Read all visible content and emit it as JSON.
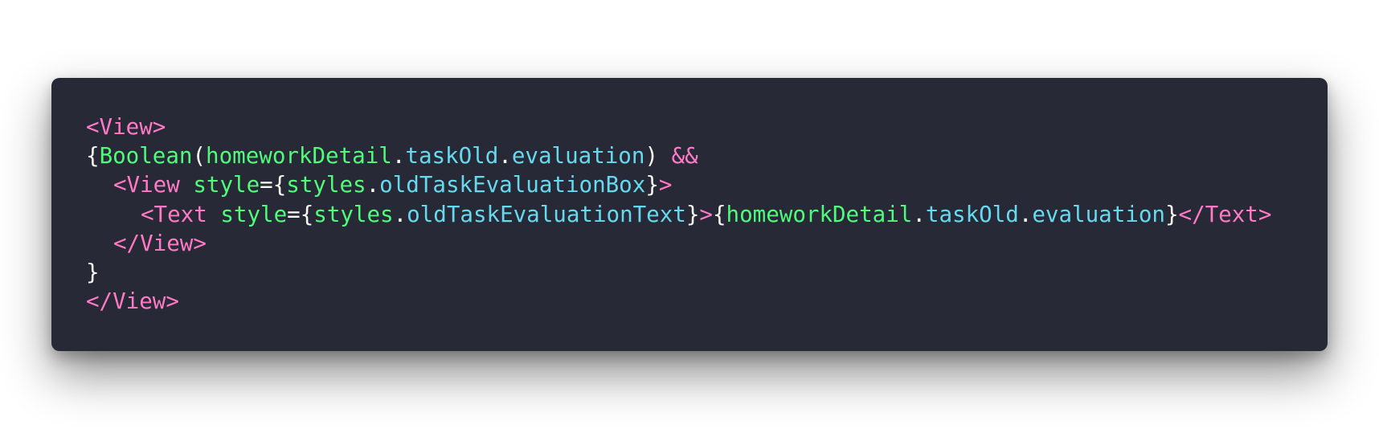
{
  "code": {
    "lines": [
      {
        "tokens": [
          {
            "t": "tag",
            "v": "<View>"
          }
        ]
      },
      {
        "tokens": [
          {
            "t": "punc",
            "v": "{"
          },
          {
            "t": "ident",
            "v": "Boolean"
          },
          {
            "t": "punc",
            "v": "("
          },
          {
            "t": "ident",
            "v": "homeworkDetail"
          },
          {
            "t": "punc",
            "v": "."
          },
          {
            "t": "prop",
            "v": "taskOld"
          },
          {
            "t": "punc",
            "v": "."
          },
          {
            "t": "prop",
            "v": "evaluation"
          },
          {
            "t": "punc",
            "v": ") "
          },
          {
            "t": "op",
            "v": "&&"
          }
        ]
      },
      {
        "tokens": [
          {
            "t": "tag",
            "v": "<View "
          },
          {
            "t": "attr",
            "v": "style"
          },
          {
            "t": "punc",
            "v": "={"
          },
          {
            "t": "ident",
            "v": "styles"
          },
          {
            "t": "punc",
            "v": "."
          },
          {
            "t": "prop",
            "v": "oldTaskEvaluationBox"
          },
          {
            "t": "punc",
            "v": "}"
          },
          {
            "t": "tag",
            "v": ">"
          }
        ]
      },
      {
        "tokens": [
          {
            "t": "tag",
            "v": "<Text "
          },
          {
            "t": "attr",
            "v": "style"
          },
          {
            "t": "punc",
            "v": "={"
          },
          {
            "t": "ident",
            "v": "styles"
          },
          {
            "t": "punc",
            "v": "."
          },
          {
            "t": "prop",
            "v": "oldTaskEvaluationText"
          },
          {
            "t": "punc",
            "v": "}"
          },
          {
            "t": "tag",
            "v": ">"
          },
          {
            "t": "punc",
            "v": "{"
          },
          {
            "t": "ident",
            "v": "homeworkDetail"
          },
          {
            "t": "punc",
            "v": "."
          },
          {
            "t": "prop",
            "v": "taskOld"
          },
          {
            "t": "punc",
            "v": "."
          },
          {
            "t": "prop",
            "v": "evaluation"
          },
          {
            "t": "punc",
            "v": "}"
          },
          {
            "t": "tag",
            "v": "</Text>"
          }
        ]
      },
      {
        "tokens": [
          {
            "t": "tag",
            "v": "</View>"
          }
        ]
      },
      {
        "tokens": [
          {
            "t": "punc",
            "v": "}"
          }
        ]
      },
      {
        "tokens": [
          {
            "t": "tag",
            "v": "</View>"
          }
        ]
      }
    ]
  }
}
